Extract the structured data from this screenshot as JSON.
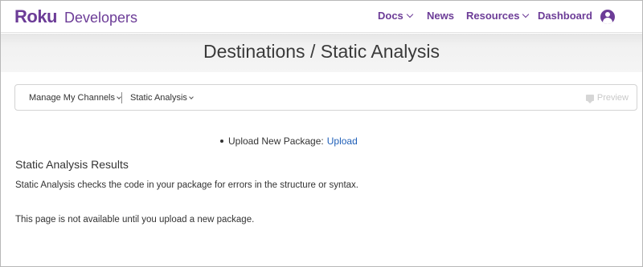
{
  "brand": {
    "logo_text": "Roku",
    "product": "Developers",
    "accent_color": "#6c3c97"
  },
  "nav": {
    "docs": "Docs",
    "news": "News",
    "resources": "Resources",
    "dashboard": "Dashboard",
    "account_icon": "user-circle-icon"
  },
  "header": {
    "title": "Destinations / Static Analysis"
  },
  "breadcrumb": {
    "channels": "Manage My Channels",
    "current": "Static Analysis",
    "preview": "Preview",
    "preview_icon": "chat-bubble-icon"
  },
  "upload": {
    "label": "Upload New Package:",
    "link": "Upload",
    "link_color": "#1f5fb8"
  },
  "results": {
    "title": "Static Analysis Results",
    "description": "Static Analysis checks the code in your package for errors in the structure or syntax.",
    "notice": "This page is not available until you upload a new package."
  }
}
